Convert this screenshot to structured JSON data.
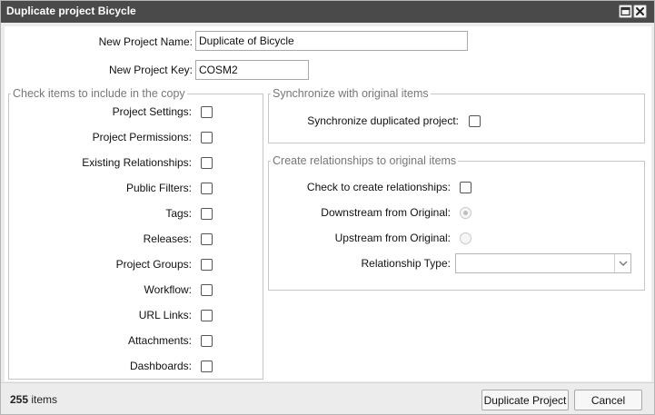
{
  "window": {
    "title": "Duplicate project Bicycle",
    "minimize_icon": "window-icon",
    "close_icon": "close-icon"
  },
  "form": {
    "name_label": "New Project Name:",
    "name_value": "Duplicate of Bicycle",
    "key_label": "New Project Key:",
    "key_value": "COSM2"
  },
  "copy_group": {
    "legend": "Check items to include in the copy",
    "items": [
      {
        "label": "Project Settings:",
        "checked": false
      },
      {
        "label": "Project Permissions:",
        "checked": false
      },
      {
        "label": "Existing Relationships:",
        "checked": false
      },
      {
        "label": "Public Filters:",
        "checked": false
      },
      {
        "label": "Tags:",
        "checked": false
      },
      {
        "label": "Releases:",
        "checked": false
      },
      {
        "label": "Project Groups:",
        "checked": false
      },
      {
        "label": "Workflow:",
        "checked": false
      },
      {
        "label": "URL Links:",
        "checked": false
      },
      {
        "label": "Attachments:",
        "checked": false
      },
      {
        "label": "Dashboards:",
        "checked": false
      }
    ]
  },
  "sync_group": {
    "legend": "Synchronize with original items",
    "sync_label": "Synchronize duplicated project:",
    "sync_checked": false
  },
  "rel_group": {
    "legend": "Create relationships to original items",
    "create_label": "Check to create relationships:",
    "create_checked": false,
    "downstream_label": "Downstream from Original:",
    "downstream_selected": true,
    "upstream_label": "Upstream from Original:",
    "upstream_selected": false,
    "type_label": "Relationship Type:",
    "type_value": ""
  },
  "footer": {
    "count": "255",
    "count_suffix": "items",
    "duplicate_button": "Duplicate Project",
    "cancel_button": "Cancel"
  }
}
